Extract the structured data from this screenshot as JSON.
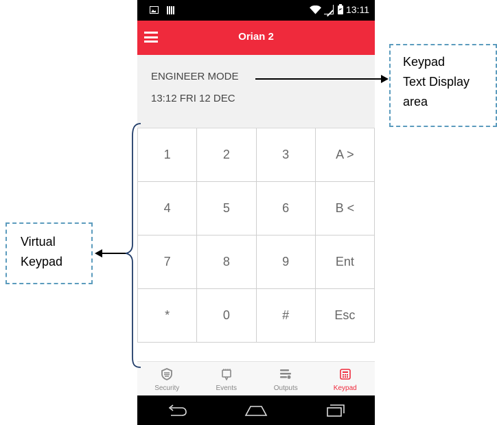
{
  "status_bar": {
    "time": "13:11"
  },
  "app_bar": {
    "title": "Orian 2"
  },
  "display": {
    "line1": "ENGINEER MODE",
    "line2": "13:12 FRI 12 DEC"
  },
  "keypad": {
    "keys": [
      "1",
      "2",
      "3",
      "A >",
      "4",
      "5",
      "6",
      "B <",
      "7",
      "8",
      "9",
      "Ent",
      "*",
      "0",
      "#",
      "Esc"
    ]
  },
  "bottom_nav": {
    "items": [
      {
        "label": "Security",
        "icon": "shield-icon"
      },
      {
        "label": "Events",
        "icon": "bell-icon"
      },
      {
        "label": "Outputs",
        "icon": "toggles-icon"
      },
      {
        "label": "Keypad",
        "icon": "keypad-icon"
      }
    ],
    "active": "Keypad",
    "active_color": "#ef2a3c"
  },
  "annotations": {
    "right_callout": [
      "Keypad",
      "Text Display",
      "area"
    ],
    "left_callout": [
      "Virtual",
      "Keypad"
    ]
  },
  "colors": {
    "accent": "#ef2a3c",
    "callout_border": "#5b9bbd"
  }
}
